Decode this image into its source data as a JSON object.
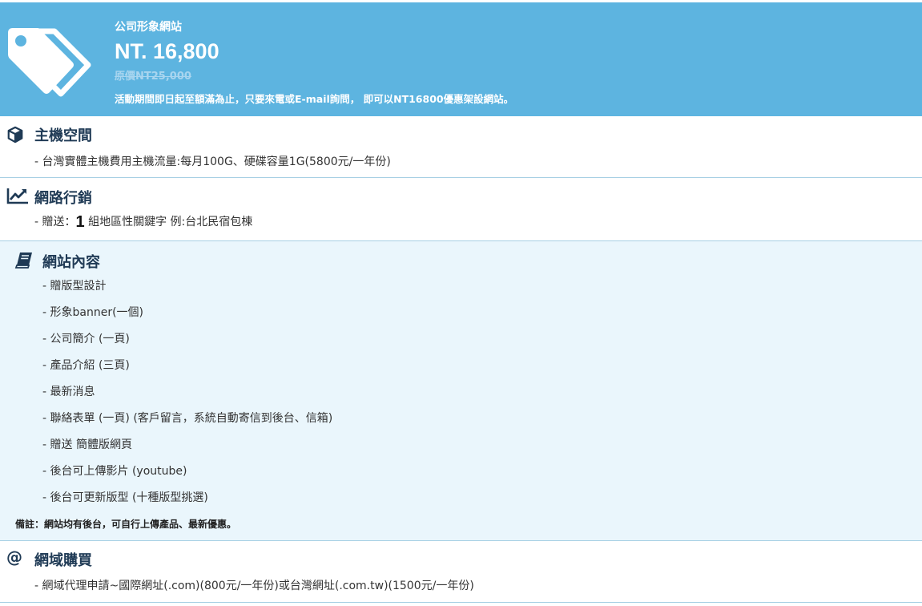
{
  "banner": {
    "icon": "price-tag-icon",
    "title": "公司形象網站",
    "price": "NT. 16,800",
    "original_price": "原價NT25,000",
    "promo": "活動期間即日起至額滿為止，只要來電或E-mail詢問， 即可以NT16800優惠架設網站。"
  },
  "hosting": {
    "icon": "cube-icon",
    "title": "主機空間",
    "item": "- 台灣實體主機費用主機流量:每月100G、硬碟容量1G(5800元/一年份)"
  },
  "marketing": {
    "icon": "trending-chart-icon",
    "title": "網路行銷",
    "prefix": "- 贈送：",
    "count": "1",
    "suffix": " 組地區性關鍵字 例:台北民宿包棟"
  },
  "content": {
    "icon": "book-icon",
    "title": "網站內容",
    "items": [
      "- 贈版型設計",
      "- 形象banner(一個)",
      "- 公司簡介 (一頁)",
      "- 產品介紹 (三頁)",
      "- 最新消息",
      "- 聯絡表單 (一頁) (客戶留言，系統自動寄信到後台、信箱)",
      "- 贈送 簡體版網頁",
      "- 後台可上傳影片 (youtube)",
      "- 後台可更新版型 (十種版型挑選)"
    ],
    "note": "備註：網站均有後台，可自行上傳產品、最新優惠。"
  },
  "domain": {
    "icon": "at-sign-icon",
    "icon_glyph": "@",
    "title": "網域購買",
    "item": "- 網域代理申請~國際網址(.com)(800元/一年份)或台灣網址(.com.tw)(1500元/一年份)"
  },
  "colors": {
    "banner_bg": "#5db4e0",
    "heading": "#1f3a55",
    "content_bg": "#eaf6fc",
    "divider": "#a7d0e4"
  }
}
